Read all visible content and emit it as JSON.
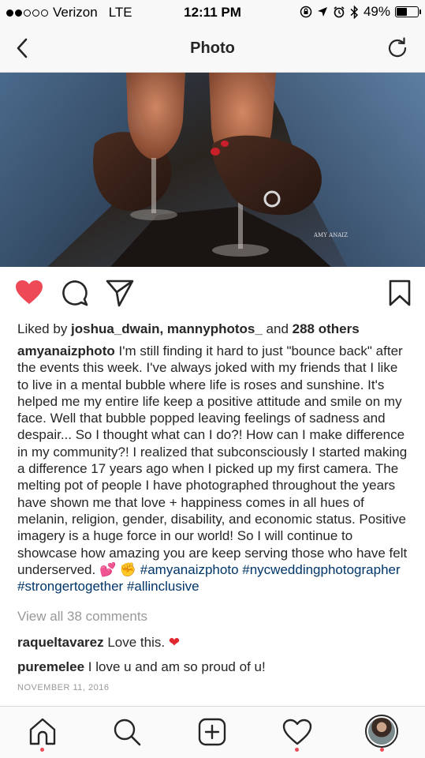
{
  "status_bar": {
    "carrier": "Verizon",
    "network": "LTE",
    "time": "12:11 PM",
    "battery_pct": "49%",
    "battery_level": 0.49,
    "signal_bars": 2
  },
  "nav": {
    "title": "Photo",
    "back_icon": "chevron-left-icon",
    "refresh_icon": "refresh-icon"
  },
  "photo": {
    "watermark": "AMY ANAIZ"
  },
  "actions": {
    "like_icon": "heart-filled-icon",
    "like_color": "#ed4956",
    "comment_icon": "comment-icon",
    "share_icon": "send-icon",
    "save_icon": "bookmark-icon"
  },
  "likes": {
    "prefix": "Liked by ",
    "user1": "joshua_dwain",
    "sep": ", ",
    "user2": "mannyphotos_",
    "and": " and ",
    "others": "288 others"
  },
  "caption": {
    "username": "amyanaizphoto",
    "text": " I'm still finding it hard to just \"bounce back\" after the events this week. I've always joked with my friends that I like to live in a mental bubble where life is roses and sunshine. It's helped me my entire life keep a positive attitude and smile on my face. Well that bubble popped leaving feelings of sadness and despair... So I thought what can I do?! How can I make difference in my community?! I realized that subconsciously I started making a difference 17 years ago when I picked up my first camera. The melting pot of people I have photographed throughout the years have shown me that love + happiness comes in all hues of melanin, religion, gender, disability, and economic status. Positive imagery is a huge force in our world! So I will continue to showcase how amazing you are keep serving those who have felt underserved. ",
    "emoji1": "💕",
    "emoji2": "✊",
    "hashtags": [
      "#amyanaizphoto",
      "#nycweddingphotographer",
      "#strongertogether",
      "#allinclusive"
    ]
  },
  "view_all_comments": "View all 38 comments",
  "comments": [
    {
      "user": "raqueltavarez",
      "text": " Love this. ",
      "emoji": "❤"
    },
    {
      "user": "puremelee",
      "text": " I love u and am so proud of u!"
    }
  ],
  "date": "NOVEMBER 11, 2016",
  "tabbar": {
    "items": [
      "home-icon",
      "search-icon",
      "add-post-icon",
      "activity-heart-icon",
      "profile-avatar"
    ]
  }
}
